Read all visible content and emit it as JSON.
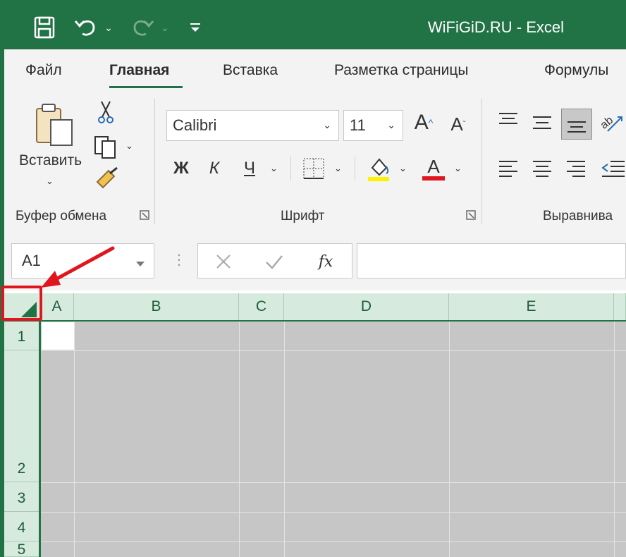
{
  "titlebar": {
    "title": "WiFiGiD.RU  -  Excel"
  },
  "tabs": [
    {
      "label": "Файл"
    },
    {
      "label": "Главная"
    },
    {
      "label": "Вставка"
    },
    {
      "label": "Разметка страницы"
    },
    {
      "label": "Формулы"
    }
  ],
  "clipboard": {
    "paste_label": "Вставить",
    "group_label": "Буфер обмена"
  },
  "font": {
    "name": "Calibri",
    "size": "11",
    "group_label": "Шрифт",
    "bold": "Ж",
    "italic": "К",
    "underline": "Ч",
    "grow": "A",
    "shrink": "A",
    "font_color": "A"
  },
  "alignment": {
    "group_label": "Выравнива"
  },
  "formula_bar": {
    "name_box": "A1",
    "fx": "fx",
    "dots": "⋮"
  },
  "columns": [
    {
      "label": "A"
    },
    {
      "label": "B"
    },
    {
      "label": "C"
    },
    {
      "label": "D"
    },
    {
      "label": "E"
    }
  ],
  "rows": [
    {
      "label": "1"
    },
    {
      "label": "2"
    },
    {
      "label": "3"
    },
    {
      "label": "4"
    },
    {
      "label": "5"
    }
  ],
  "colors": {
    "excel_green": "#217346",
    "selection": "#c6c6c6",
    "header_bg": "#d6ebdd",
    "annotation": "#e0161f"
  }
}
